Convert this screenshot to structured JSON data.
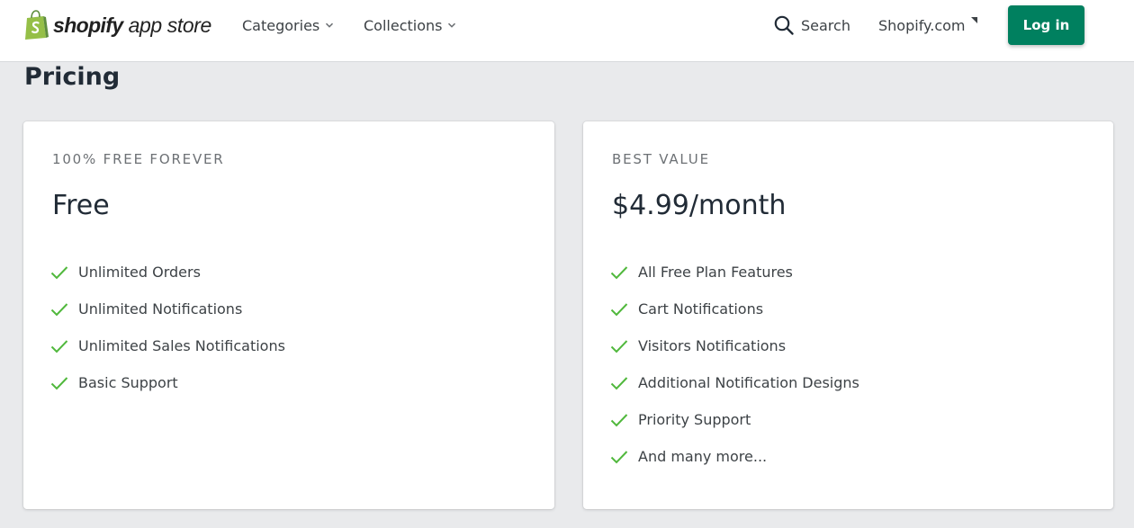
{
  "header": {
    "logo": {
      "wordmark": "shopify",
      "subtitle": "app store",
      "icon": "shopify-bag-icon",
      "bag_color": "#95bf47"
    },
    "nav": [
      {
        "label": "Categories",
        "icon": "chevron-down-icon"
      },
      {
        "label": "Collections",
        "icon": "chevron-down-icon"
      }
    ],
    "search": {
      "label": "Search",
      "icon": "search-icon"
    },
    "external_link": {
      "label": "Shopify.com",
      "icon": "external-link-icon"
    },
    "login": {
      "label": "Log in",
      "color": "#00805f"
    }
  },
  "pricing": {
    "title": "Pricing",
    "check_color": "#50b83c",
    "plans": [
      {
        "label": "100% FREE FOREVER",
        "price": "Free",
        "features": [
          "Unlimited Orders",
          "Unlimited Notifications",
          "Unlimited Sales Notifications",
          "Basic Support"
        ]
      },
      {
        "label": "BEST VALUE",
        "price": "$4.99/month",
        "features": [
          "All Free Plan Features",
          "Cart Notifications",
          "Visitors Notifications",
          "Additional Notification Designs",
          "Priority Support",
          "And many more..."
        ]
      }
    ]
  }
}
